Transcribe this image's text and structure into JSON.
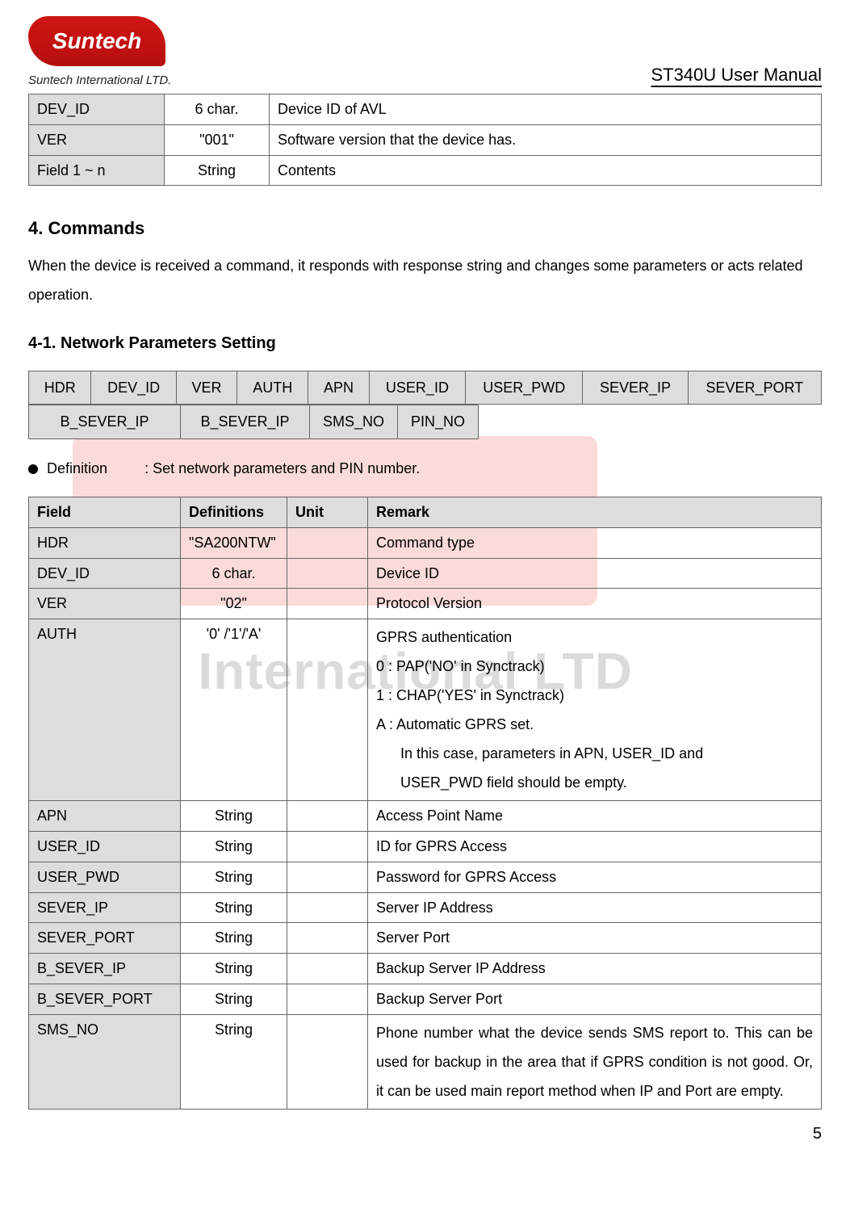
{
  "header": {
    "logo_text": "Suntech",
    "logo_sub": "Suntech International LTD.",
    "doc_title": "ST340U User Manual"
  },
  "watermark": {
    "text": "ch International LTD"
  },
  "table1": {
    "rows": [
      {
        "field": "DEV_ID",
        "def": "6 char.",
        "remark": "Device ID of AVL"
      },
      {
        "field": "VER",
        "def": "\"001\"",
        "remark": "Software version that the device has."
      },
      {
        "field": "Field 1 ~ n",
        "def": "String",
        "remark": "Contents"
      }
    ]
  },
  "section4": {
    "title": "4. Commands",
    "para": "When the device is received a command, it responds with response string and changes some parameters or acts related operation."
  },
  "section41": {
    "title": "4-1. Network Parameters Setting",
    "header_row1": [
      "HDR",
      "DEV_ID",
      "VER",
      "AUTH",
      "APN",
      "USER_ID",
      "USER_PWD",
      "SEVER_IP",
      "SEVER_PORT"
    ],
    "header_row2": [
      "B_SEVER_IP",
      "B_SEVER_IP",
      "SMS_NO",
      "PIN_NO"
    ],
    "definition_label": "Definition",
    "definition_text": ": Set network parameters and PIN number.",
    "def_headers": [
      "Field",
      "Definitions",
      "Unit",
      "Remark"
    ],
    "def_rows": [
      {
        "field": "HDR",
        "def": "\"SA200NTW\"",
        "unit": "",
        "remark": "Command type"
      },
      {
        "field": "DEV_ID",
        "def": "6 char.",
        "unit": "",
        "remark": "Device ID"
      },
      {
        "field": "VER",
        "def": "\"02\"",
        "unit": "",
        "remark": "Protocol Version"
      },
      {
        "field": "AUTH",
        "def": "'0' /'1'/'A'",
        "unit": "",
        "remark_lines": [
          "GPRS authentication",
          "0 : PAP('NO' in Synctrack)",
          "1 : CHAP('YES' in Synctrack)",
          "A : Automatic GPRS set."
        ],
        "remark_indent": [
          "In this case, parameters in APN, USER_ID and",
          "USER_PWD field should be empty."
        ]
      },
      {
        "field": "APN",
        "def": "String",
        "unit": "",
        "remark": "Access Point Name"
      },
      {
        "field": "USER_ID",
        "def": "String",
        "unit": "",
        "remark": "ID for GPRS Access"
      },
      {
        "field": "USER_PWD",
        "def": "String",
        "unit": "",
        "remark": "Password for GPRS Access"
      },
      {
        "field": "SEVER_IP",
        "def": "String",
        "unit": "",
        "remark": "Server IP Address"
      },
      {
        "field": "SEVER_PORT",
        "def": "String",
        "unit": "",
        "remark": "Server Port"
      },
      {
        "field": "B_SEVER_IP",
        "def": "String",
        "unit": "",
        "remark": "Backup Server IP Address"
      },
      {
        "field": "B_SEVER_PORT",
        "def": "String",
        "unit": "",
        "remark": "Backup Server Port"
      },
      {
        "field": "SMS_NO",
        "def": "String",
        "unit": "",
        "remark_multi": "Phone number what the device sends SMS report to. This can be used for backup in the area that if GPRS condition is not good. Or, it can be used main report method when IP and Port are empty."
      }
    ]
  },
  "page_number": "5"
}
